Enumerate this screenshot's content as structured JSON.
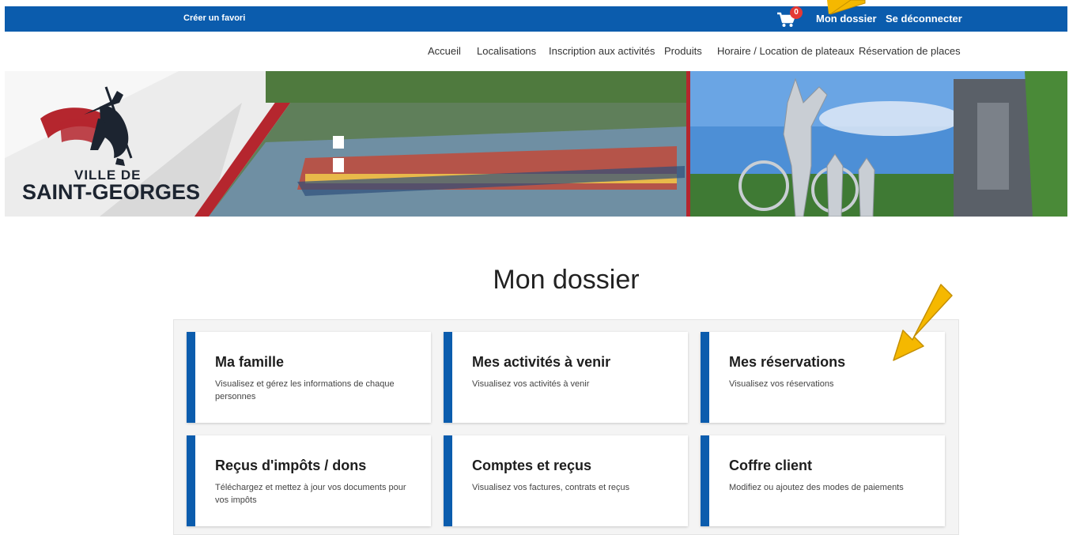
{
  "topbar": {
    "favori_label": "Créer un favori",
    "cart_count": "0",
    "mon_dossier_label": "Mon dossier",
    "logout_label": "Se déconnecter"
  },
  "nav": {
    "items": [
      "Accueil",
      "Localisations",
      "Inscription aux activités",
      "Produits",
      "Horaire / Location de plateaux",
      "Réservation de places"
    ]
  },
  "banner": {
    "logo_line1": "VILLE DE",
    "logo_line2": "SAINT-GEORGES"
  },
  "main": {
    "title": "Mon dossier",
    "cards": [
      {
        "title": "Ma famille",
        "desc": "Visualisez et gérez les informations de chaque personnes"
      },
      {
        "title": "Mes activités à venir",
        "desc": "Visualisez vos activités à venir"
      },
      {
        "title": "Mes réservations",
        "desc": "Visualisez vos réservations"
      },
      {
        "title": "Reçus d'impôts / dons",
        "desc": "Téléchargez et mettez à jour vos documents pour vos impôts"
      },
      {
        "title": "Comptes et reçus",
        "desc": "Visualisez vos factures, contrats et reçus"
      },
      {
        "title": "Coffre client",
        "desc": "Modifiez ou ajoutez des modes de paiements"
      }
    ]
  },
  "colors": {
    "brand_blue": "#0b5cad",
    "brand_red": "#b5262e",
    "arrow_yellow": "#f5b800"
  }
}
